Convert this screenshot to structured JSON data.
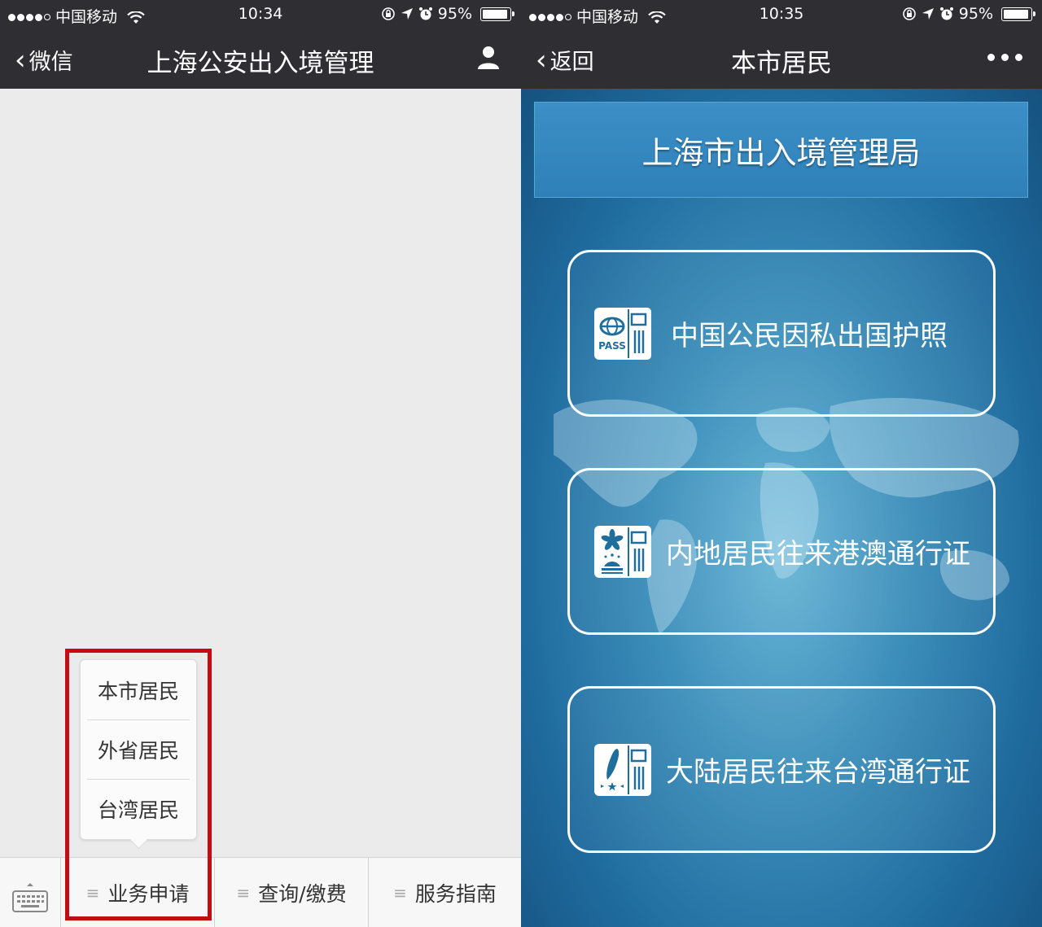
{
  "colors": {
    "nav_bar": "#2f2f33",
    "left_bg": "#ebebeb",
    "right_bg": "#1e6f9e",
    "highlight": "#c30d12"
  },
  "left": {
    "status": {
      "carrier": "中国移动",
      "time": "10:34",
      "battery": "95%",
      "battery_level": 0.95
    },
    "nav": {
      "back_label": "微信",
      "title": "上海公安出入境管理",
      "action_icon": "person-icon"
    },
    "popup_items": [
      "本市居民",
      "外省居民",
      "台湾居民"
    ],
    "menu_tabs": [
      "业务申请",
      "查询/缴费",
      "服务指南"
    ],
    "keyboard_icon": "keyboard-icon"
  },
  "right": {
    "status": {
      "carrier": "中国移动",
      "time": "10:35",
      "battery": "95%",
      "battery_level": 0.95
    },
    "nav": {
      "back_label": "返回",
      "title": "本市居民",
      "action_icon": "more-dots-icon"
    },
    "banner": "上海市出入境管理局",
    "cards": [
      {
        "label": "中国公民因私出国护照",
        "icon": "passport-icon",
        "icon_text": "PASS"
      },
      {
        "label": "内地居民往来港澳通行证",
        "icon": "hk-macau-pass-icon"
      },
      {
        "label": "大陆居民往来台湾通行证",
        "icon": "taiwan-pass-icon"
      }
    ]
  }
}
